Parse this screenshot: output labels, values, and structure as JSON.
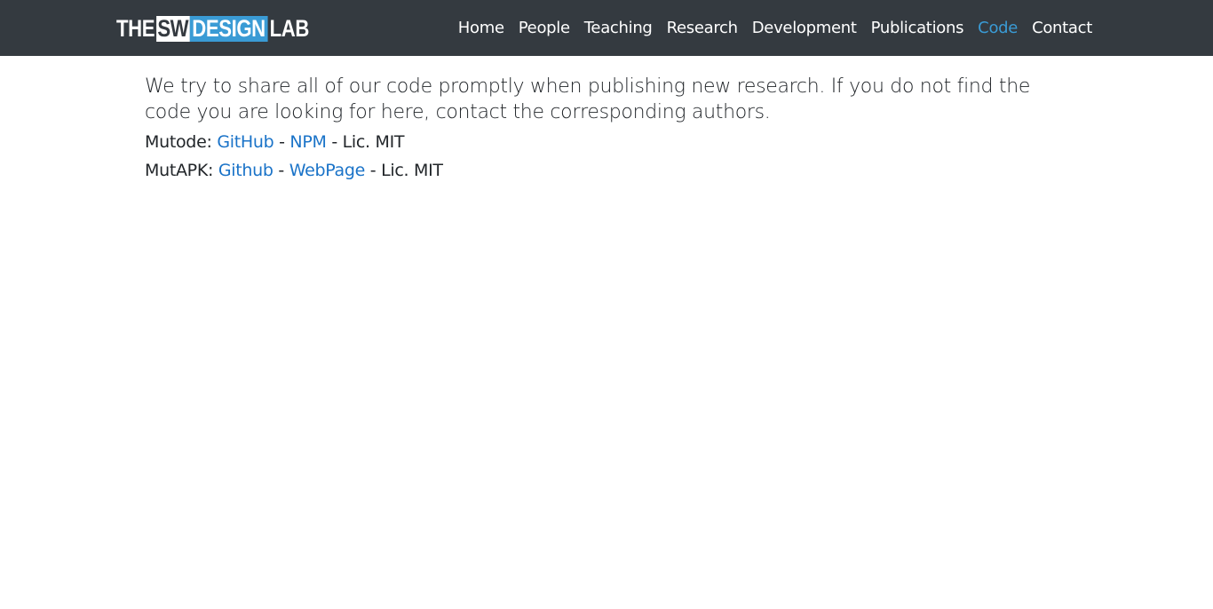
{
  "brand": {
    "the": "THE",
    "sw": "SW",
    "design": "DESIGN",
    "lab": "LAB"
  },
  "nav": {
    "items": [
      {
        "label": "Home"
      },
      {
        "label": "People"
      },
      {
        "label": "Teaching"
      },
      {
        "label": "Research"
      },
      {
        "label": "Development"
      },
      {
        "label": "Publications"
      },
      {
        "label": "Code",
        "active": true
      },
      {
        "label": "Contact"
      }
    ]
  },
  "main": {
    "intro": "We try to share all of our code promptly when publishing new research. If you do not find the code you are looking for here, contact the corresponding authors.",
    "projects": [
      {
        "name": "Mutode:",
        "link1": "GitHub",
        "sep": "-",
        "link2": "NPM",
        "license": "- Lic. MIT"
      },
      {
        "name": "MutAPK:",
        "link1": "Github",
        "sep": "-",
        "link2": "WebPage",
        "license": "- Lic. MIT"
      }
    ]
  },
  "colors": {
    "navbar": "#343a40",
    "accent": "#3a9bd5",
    "link": "#1a73c8"
  }
}
